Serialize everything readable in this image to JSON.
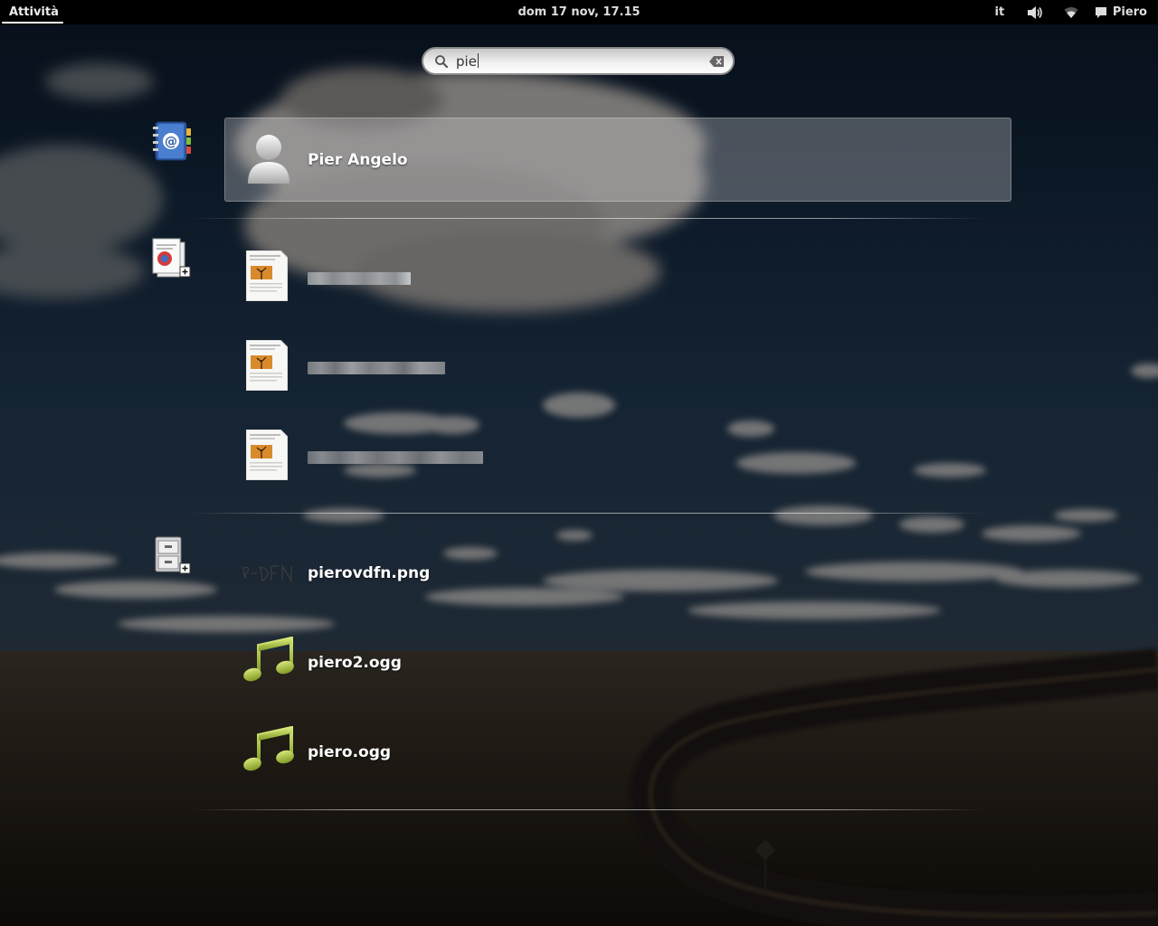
{
  "topbar": {
    "activities_label": "Attività",
    "clock": "dom 17 nov, 17.15",
    "language": "it",
    "user_name": "Piero",
    "icons": [
      "volume-icon",
      "wifi-icon",
      "chat-icon"
    ]
  },
  "search": {
    "query": "pie",
    "icons": [
      "search-icon",
      "clear-icon"
    ]
  },
  "results": {
    "contacts": {
      "provider_icon": "address-book-icon",
      "items": [
        {
          "label": "Pier Angelo",
          "icon": "avatar-icon"
        }
      ]
    },
    "documents": {
      "provider_icon": "documents-app-icon",
      "items": [
        {
          "label_redacted": true,
          "icon": "document-thumbnail"
        },
        {
          "label_redacted": true,
          "icon": "document-thumbnail"
        },
        {
          "label_redacted": true,
          "icon": "document-thumbnail"
        }
      ]
    },
    "files": {
      "provider_icon": "file-cabinet-icon",
      "items": [
        {
          "label": "pierovdfn.png",
          "icon": "signature-image-thumbnail"
        },
        {
          "label": "piero2.ogg",
          "icon": "music-note-icon"
        },
        {
          "label": "piero.ogg",
          "icon": "music-note-icon"
        }
      ]
    }
  },
  "colors": {
    "topbar": "#000000",
    "selected_row": "#a9a9ad",
    "music_note": "#a8c23a"
  }
}
